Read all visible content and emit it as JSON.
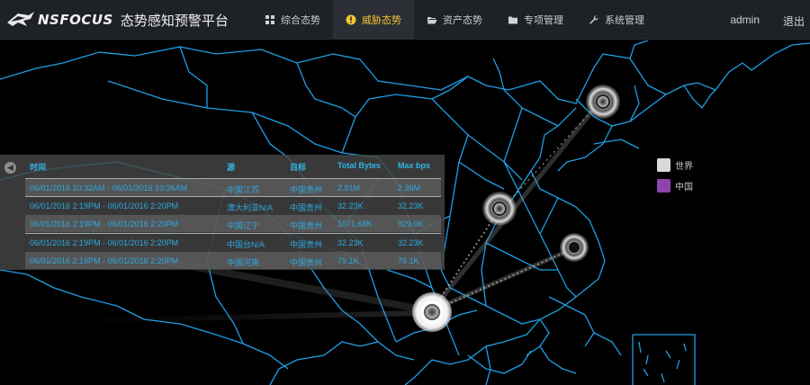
{
  "header": {
    "brand_name": "NSFOCUS",
    "app_title": "态势感知预警平台",
    "nav": [
      {
        "label": "综合态势",
        "icon": "grid-icon",
        "active": false
      },
      {
        "label": "威胁态势",
        "icon": "alert-icon",
        "active": true
      },
      {
        "label": "资产态势",
        "icon": "folder-open-icon",
        "active": false
      },
      {
        "label": "专项管理",
        "icon": "folder-icon",
        "active": false
      },
      {
        "label": "系统管理",
        "icon": "wrench-icon",
        "active": false
      }
    ],
    "user": "admin",
    "logout": "退出"
  },
  "table": {
    "toggle_icon": "collapse-icon",
    "columns": [
      "时间",
      "源",
      "目标",
      "Total Bytes",
      "Max bps"
    ],
    "rows": [
      {
        "time": "06/01/2016 10:32AM - 06/01/2016 10:36AM",
        "source": "中国江苏",
        "target": "中国贵州",
        "total_bytes": "2.81M",
        "max_bps": "2.36M"
      },
      {
        "time": "06/01/2016 2:19PM - 06/01/2016 2:20PM",
        "source": "澳大利亚N/A",
        "target": "中国贵州",
        "total_bytes": "32.23K",
        "max_bps": "32.23K"
      },
      {
        "time": "06/01/2016 2:19PM - 06/01/2016 2:20PM",
        "source": "中国辽宁",
        "target": "中国贵州",
        "total_bytes": "1071.68K",
        "max_bps": "929.0K"
      },
      {
        "time": "06/01/2016 2:19PM - 06/01/2016 2:20PM",
        "source": "中国台N/A",
        "target": "中国贵州",
        "total_bytes": "32.23K",
        "max_bps": "32.23K"
      },
      {
        "time": "06/01/2016 2:19PM - 06/01/2016 2:20PM",
        "source": "中国河南",
        "target": "中国贵州",
        "total_bytes": "79.1K",
        "max_bps": "79.1K"
      }
    ]
  },
  "legend": [
    {
      "label": "世界",
      "color": "#d9d9d9"
    },
    {
      "label": "中国",
      "color": "#8e44ad"
    }
  ],
  "colors": {
    "accent": "#f4c430",
    "border": "#1e9fe6",
    "link": "#2ea8e0"
  }
}
